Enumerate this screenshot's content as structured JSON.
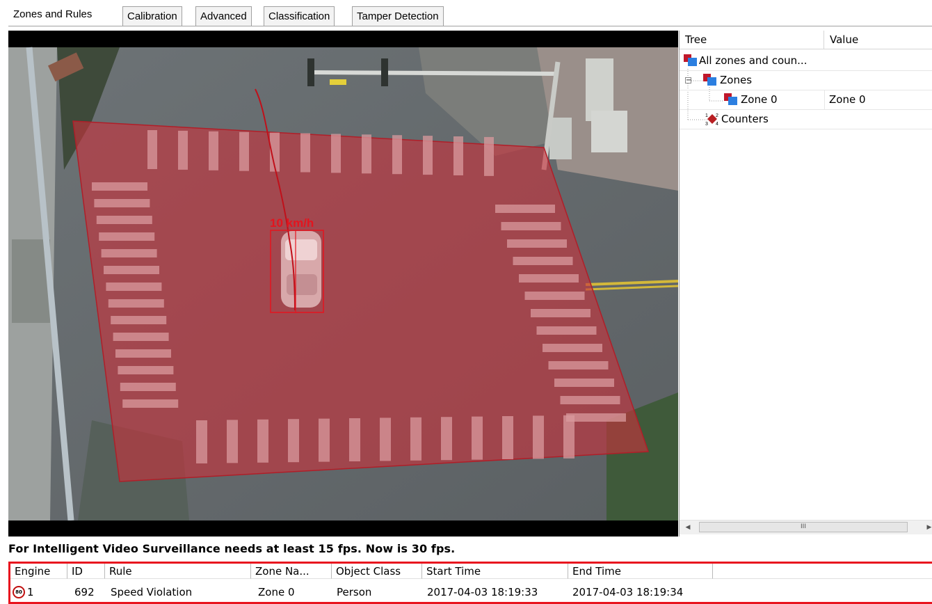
{
  "tabs": [
    {
      "label": "Zones and Rules",
      "active": true
    },
    {
      "label": "Calibration",
      "active": false
    },
    {
      "label": "Advanced",
      "active": false
    },
    {
      "label": "Classification",
      "active": false
    },
    {
      "label": "Tamper Detection",
      "active": false
    }
  ],
  "video": {
    "speed_label": "10 km/h"
  },
  "tree": {
    "columns": [
      "Tree",
      "Value"
    ],
    "rows": [
      {
        "label": "All zones and coun...",
        "value": "",
        "icon": "zones-icon"
      },
      {
        "label": "Zones",
        "value": "",
        "icon": "zones-icon"
      },
      {
        "label": "Zone 0",
        "value": "Zone 0",
        "icon": "zones-icon"
      },
      {
        "label": "Counters",
        "value": "",
        "icon": "counters-icon"
      }
    ],
    "scroll_thumb_glyph": "III"
  },
  "status_message": "For Intelligent Video Surveillance needs at least 15 fps. Now is 30 fps.",
  "events": {
    "columns": [
      "Engine",
      "ID",
      "Rule",
      "Zone Na...",
      "Object Class",
      "Start Time",
      "End Time"
    ],
    "rows": [
      {
        "engine": "1",
        "engine_icon": "speed-limit-icon",
        "engine_icon_text": "80",
        "id": "692",
        "rule": "Speed Violation",
        "zone": "Zone 0",
        "object_class": "Person",
        "start": "2017-04-03 18:19:33",
        "end": "2017-04-03 18:19:34"
      }
    ]
  },
  "colors": {
    "zone_overlay": "#c8323c",
    "highlight_border": "#e8141e"
  }
}
